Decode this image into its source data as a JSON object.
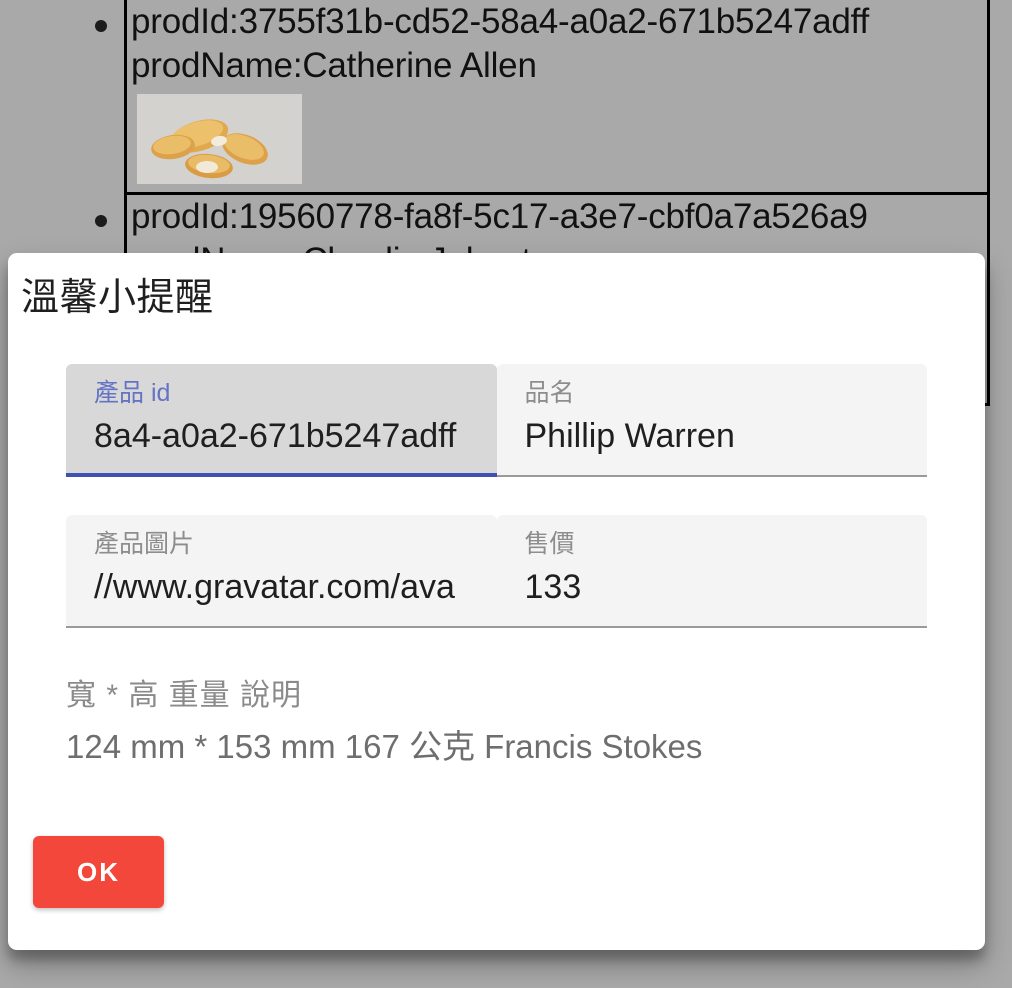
{
  "background": {
    "products": [
      {
        "id_line": "prodId:3755f31b-cd52-58a4-a0a2-671b5247adff",
        "name_line": "prodName:Catherine Allen",
        "image_alt": "chicken-nuggets-photo"
      },
      {
        "id_line": "prodId:19560778-fa8f-5c17-a3e7-cbf0a7a526a9",
        "name_line": "prodName:Claudia Johnston"
      }
    ]
  },
  "dialog": {
    "title": "溫馨小提醒",
    "fields": [
      {
        "label": "產品 id",
        "value": "8a4-a0a2-671b5247adff",
        "focused": true
      },
      {
        "label": "品名",
        "value": "Phillip Warren",
        "focused": false
      },
      {
        "label": "產品圖片",
        "value": "//www.gravatar.com/ava",
        "focused": false
      },
      {
        "label": "售價",
        "value": "133",
        "focused": false
      }
    ],
    "meta": {
      "heading": "寬 * 高 重量 說明",
      "value": "124 mm * 153 mm 167 公克 Francis Stokes"
    },
    "ok_label": "OK"
  },
  "colors": {
    "page_background": "#a9a9a9",
    "dialog_background": "#ffffff",
    "field_background": "#f4f4f4",
    "field_background_focused": "#d8d8d8",
    "focus_accent": "#3f51b5",
    "focus_label": "#6573c3",
    "ok_button": "#f4473b",
    "muted_text": "#8a8a8a"
  }
}
